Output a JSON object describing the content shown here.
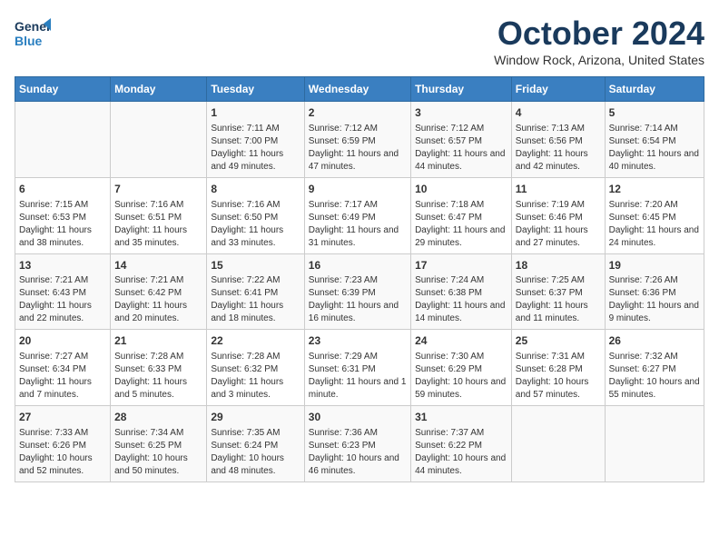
{
  "header": {
    "logo_line1": "General",
    "logo_line2": "Blue",
    "month": "October 2024",
    "location": "Window Rock, Arizona, United States"
  },
  "days_of_week": [
    "Sunday",
    "Monday",
    "Tuesday",
    "Wednesday",
    "Thursday",
    "Friday",
    "Saturday"
  ],
  "weeks": [
    [
      {
        "day": "",
        "info": ""
      },
      {
        "day": "",
        "info": ""
      },
      {
        "day": "1",
        "info": "Sunrise: 7:11 AM\nSunset: 7:00 PM\nDaylight: 11 hours and 49 minutes."
      },
      {
        "day": "2",
        "info": "Sunrise: 7:12 AM\nSunset: 6:59 PM\nDaylight: 11 hours and 47 minutes."
      },
      {
        "day": "3",
        "info": "Sunrise: 7:12 AM\nSunset: 6:57 PM\nDaylight: 11 hours and 44 minutes."
      },
      {
        "day": "4",
        "info": "Sunrise: 7:13 AM\nSunset: 6:56 PM\nDaylight: 11 hours and 42 minutes."
      },
      {
        "day": "5",
        "info": "Sunrise: 7:14 AM\nSunset: 6:54 PM\nDaylight: 11 hours and 40 minutes."
      }
    ],
    [
      {
        "day": "6",
        "info": "Sunrise: 7:15 AM\nSunset: 6:53 PM\nDaylight: 11 hours and 38 minutes."
      },
      {
        "day": "7",
        "info": "Sunrise: 7:16 AM\nSunset: 6:51 PM\nDaylight: 11 hours and 35 minutes."
      },
      {
        "day": "8",
        "info": "Sunrise: 7:16 AM\nSunset: 6:50 PM\nDaylight: 11 hours and 33 minutes."
      },
      {
        "day": "9",
        "info": "Sunrise: 7:17 AM\nSunset: 6:49 PM\nDaylight: 11 hours and 31 minutes."
      },
      {
        "day": "10",
        "info": "Sunrise: 7:18 AM\nSunset: 6:47 PM\nDaylight: 11 hours and 29 minutes."
      },
      {
        "day": "11",
        "info": "Sunrise: 7:19 AM\nSunset: 6:46 PM\nDaylight: 11 hours and 27 minutes."
      },
      {
        "day": "12",
        "info": "Sunrise: 7:20 AM\nSunset: 6:45 PM\nDaylight: 11 hours and 24 minutes."
      }
    ],
    [
      {
        "day": "13",
        "info": "Sunrise: 7:21 AM\nSunset: 6:43 PM\nDaylight: 11 hours and 22 minutes."
      },
      {
        "day": "14",
        "info": "Sunrise: 7:21 AM\nSunset: 6:42 PM\nDaylight: 11 hours and 20 minutes."
      },
      {
        "day": "15",
        "info": "Sunrise: 7:22 AM\nSunset: 6:41 PM\nDaylight: 11 hours and 18 minutes."
      },
      {
        "day": "16",
        "info": "Sunrise: 7:23 AM\nSunset: 6:39 PM\nDaylight: 11 hours and 16 minutes."
      },
      {
        "day": "17",
        "info": "Sunrise: 7:24 AM\nSunset: 6:38 PM\nDaylight: 11 hours and 14 minutes."
      },
      {
        "day": "18",
        "info": "Sunrise: 7:25 AM\nSunset: 6:37 PM\nDaylight: 11 hours and 11 minutes."
      },
      {
        "day": "19",
        "info": "Sunrise: 7:26 AM\nSunset: 6:36 PM\nDaylight: 11 hours and 9 minutes."
      }
    ],
    [
      {
        "day": "20",
        "info": "Sunrise: 7:27 AM\nSunset: 6:34 PM\nDaylight: 11 hours and 7 minutes."
      },
      {
        "day": "21",
        "info": "Sunrise: 7:28 AM\nSunset: 6:33 PM\nDaylight: 11 hours and 5 minutes."
      },
      {
        "day": "22",
        "info": "Sunrise: 7:28 AM\nSunset: 6:32 PM\nDaylight: 11 hours and 3 minutes."
      },
      {
        "day": "23",
        "info": "Sunrise: 7:29 AM\nSunset: 6:31 PM\nDaylight: 11 hours and 1 minute."
      },
      {
        "day": "24",
        "info": "Sunrise: 7:30 AM\nSunset: 6:29 PM\nDaylight: 10 hours and 59 minutes."
      },
      {
        "day": "25",
        "info": "Sunrise: 7:31 AM\nSunset: 6:28 PM\nDaylight: 10 hours and 57 minutes."
      },
      {
        "day": "26",
        "info": "Sunrise: 7:32 AM\nSunset: 6:27 PM\nDaylight: 10 hours and 55 minutes."
      }
    ],
    [
      {
        "day": "27",
        "info": "Sunrise: 7:33 AM\nSunset: 6:26 PM\nDaylight: 10 hours and 52 minutes."
      },
      {
        "day": "28",
        "info": "Sunrise: 7:34 AM\nSunset: 6:25 PM\nDaylight: 10 hours and 50 minutes."
      },
      {
        "day": "29",
        "info": "Sunrise: 7:35 AM\nSunset: 6:24 PM\nDaylight: 10 hours and 48 minutes."
      },
      {
        "day": "30",
        "info": "Sunrise: 7:36 AM\nSunset: 6:23 PM\nDaylight: 10 hours and 46 minutes."
      },
      {
        "day": "31",
        "info": "Sunrise: 7:37 AM\nSunset: 6:22 PM\nDaylight: 10 hours and 44 minutes."
      },
      {
        "day": "",
        "info": ""
      },
      {
        "day": "",
        "info": ""
      }
    ]
  ]
}
